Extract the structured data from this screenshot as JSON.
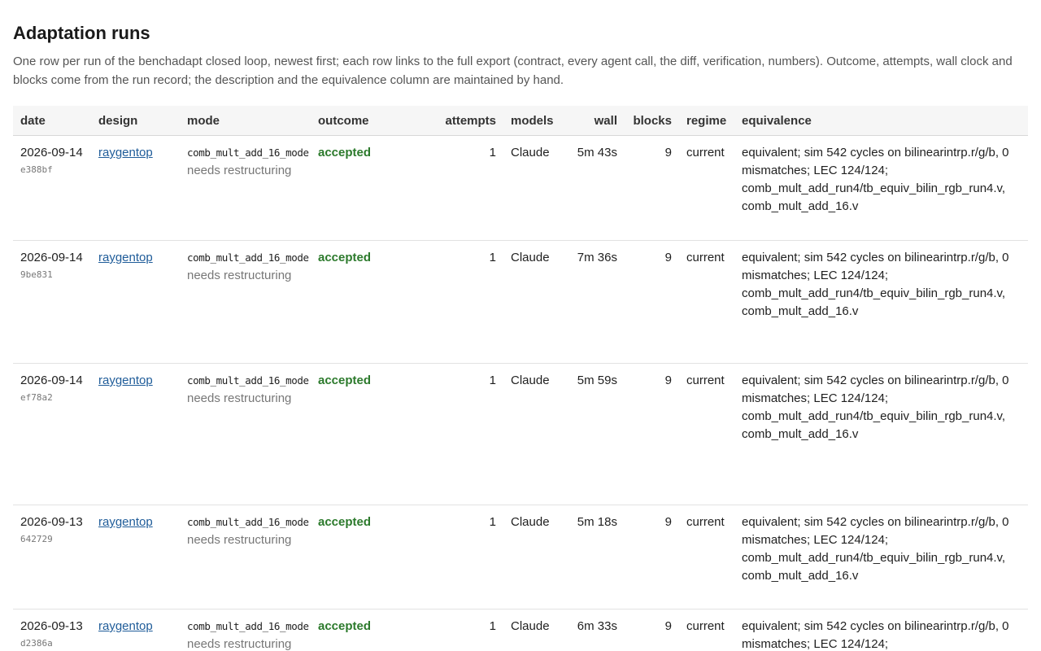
{
  "page": {
    "title": "Adaptation runs",
    "description": "One row per run of the benchadapt closed loop, newest first; each row links to the full export (contract, every agent call, the diff, verification, numbers). Outcome, attempts, wall clock and blocks come from the run record; the description and the equivalence column are maintained by hand."
  },
  "table": {
    "headers": {
      "date": "date",
      "design": "design",
      "mode": "mode",
      "outcome": "outcome",
      "attempts": "attempts",
      "models": "models",
      "wall": "wall",
      "blocks": "blocks",
      "regime": "regime",
      "equivalence": "equivalence"
    },
    "rows": [
      {
        "date": "2026-09-14",
        "hash": "e388bf",
        "design": "raygentop",
        "mode": "comb_mult_add_16_mode",
        "mode_note": "needs restructuring",
        "outcome": "accepted",
        "attempts": "1",
        "models": "Claude",
        "wall": "5m 43s",
        "blocks": "9",
        "regime": "current",
        "equivalence": "equivalent; sim 542 cycles on bilinearintrp.r/g/b, 0 mismatches; LEC 124/124; comb_mult_add_run4/tb_equiv_bilin_rgb_run4.v, comb_mult_add_16.v"
      },
      {
        "date": "2026-09-14",
        "hash": "9be831",
        "design": "raygentop",
        "mode": "comb_mult_add_16_mode",
        "mode_note": "needs restructuring",
        "outcome": "accepted",
        "attempts": "1",
        "models": "Claude",
        "wall": "7m 36s",
        "blocks": "9",
        "regime": "current",
        "equivalence": "equivalent; sim 542 cycles on bilinearintrp.r/g/b, 0 mismatches; LEC 124/124; comb_mult_add_run4/tb_equiv_bilin_rgb_run4.v, comb_mult_add_16.v"
      },
      {
        "date": "2026-09-14",
        "hash": "ef78a2",
        "design": "raygentop",
        "mode": "comb_mult_add_16_mode",
        "mode_note": "needs restructuring",
        "outcome": "accepted",
        "attempts": "1",
        "models": "Claude",
        "wall": "5m 59s",
        "blocks": "9",
        "regime": "current",
        "equivalence": "equivalent; sim 542 cycles on bilinearintrp.r/g/b, 0 mismatches; LEC 124/124; comb_mult_add_run4/tb_equiv_bilin_rgb_run4.v, comb_mult_add_16.v"
      },
      {
        "date": "2026-09-13",
        "hash": "642729",
        "design": "raygentop",
        "mode": "comb_mult_add_16_mode",
        "mode_note": "needs restructuring",
        "outcome": "accepted",
        "attempts": "1",
        "models": "Claude",
        "wall": "5m 18s",
        "blocks": "9",
        "regime": "current",
        "equivalence": "equivalent; sim 542 cycles on bilinearintrp.r/g/b, 0 mismatches; LEC 124/124; comb_mult_add_run4/tb_equiv_bilin_rgb_run4.v, comb_mult_add_16.v"
      },
      {
        "date": "2026-09-13",
        "hash": "d2386a",
        "design": "raygentop",
        "mode": "comb_mult_add_16_mode",
        "mode_note": "needs restructuring",
        "outcome": "accepted",
        "attempts": "1",
        "models": "Claude",
        "wall": "6m 33s",
        "blocks": "9",
        "regime": "current",
        "equivalence": "equivalent; sim 542 cycles on bilinearintrp.r/g/b, 0 mismatches; LEC 124/124;"
      }
    ]
  }
}
